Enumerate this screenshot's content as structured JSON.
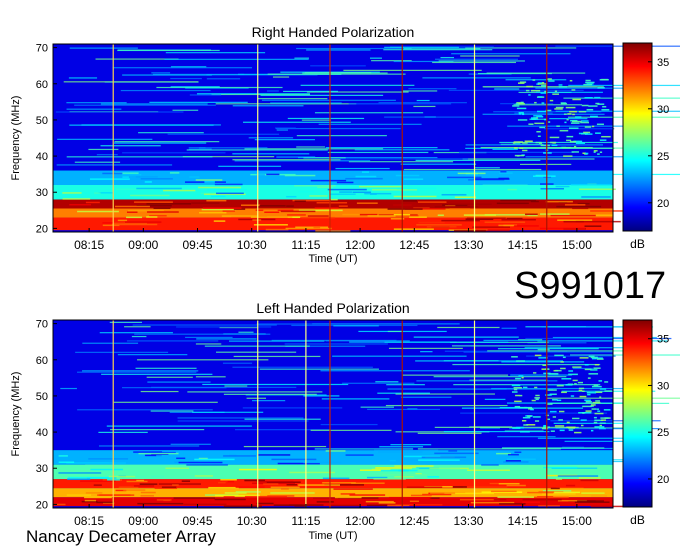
{
  "figure": {
    "observation_id": "S991017",
    "footer_label": "Nancay Decameter Array"
  },
  "colorbar": {
    "unit": "dB",
    "ticks": [
      20,
      25,
      30,
      35
    ],
    "range": [
      17,
      37
    ],
    "colormap": [
      "#00007f",
      "#0000ff",
      "#007fff",
      "#00ffff",
      "#7fff7f",
      "#ffff00",
      "#ff7f00",
      "#ff0000",
      "#7f0000"
    ]
  },
  "chart_data": [
    {
      "type": "heatmap",
      "title": "Right Handed Polarization",
      "xlabel": "Time (UT)",
      "ylabel": "Frequency (MHz)",
      "x_ticks": [
        "08:15",
        "09:00",
        "09:45",
        "10:30",
        "11:15",
        "12:00",
        "12:45",
        "13:30",
        "14:15",
        "15:00"
      ],
      "y_ticks": [
        20,
        30,
        40,
        50,
        60,
        70
      ],
      "ylim": [
        19,
        71
      ],
      "z_unit": "dB",
      "z_range": [
        17,
        37
      ],
      "background_db": 19,
      "intense_bands": [
        {
          "freq_range": [
            19.5,
            23
          ],
          "db": 34
        },
        {
          "freq_range": [
            23,
            25.5
          ],
          "db": 32
        },
        {
          "freq_range": [
            25.5,
            28
          ],
          "db": 36
        },
        {
          "freq_range": [
            28,
            32
          ],
          "db": 25
        },
        {
          "freq_range": [
            32,
            36
          ],
          "db": 23
        }
      ],
      "vertical_lines": [
        {
          "time": "08:35",
          "color": "#ffd24d"
        },
        {
          "time": "10:35",
          "color": "#ffff80"
        },
        {
          "time": "11:35",
          "color": "#cc2200"
        },
        {
          "time": "12:35",
          "color": "#aa1100"
        },
        {
          "time": "13:35",
          "color": "#ffff80"
        },
        {
          "time": "14:35",
          "color": "#aa1100"
        }
      ]
    },
    {
      "type": "heatmap",
      "title": "Left Handed Polarization",
      "xlabel": "Time (UT)",
      "ylabel": "Frequency (MHz)",
      "x_ticks": [
        "08:15",
        "09:00",
        "09:45",
        "10:30",
        "11:15",
        "12:00",
        "12:45",
        "13:30",
        "14:15",
        "15:00"
      ],
      "y_ticks": [
        20,
        30,
        40,
        50,
        60,
        70
      ],
      "ylim": [
        19,
        71
      ],
      "z_unit": "dB",
      "z_range": [
        17,
        37
      ],
      "background_db": 19,
      "intense_bands": [
        {
          "freq_range": [
            19.5,
            22
          ],
          "db": 35
        },
        {
          "freq_range": [
            22,
            24.5
          ],
          "db": 31
        },
        {
          "freq_range": [
            24.5,
            27
          ],
          "db": 34
        },
        {
          "freq_range": [
            27,
            31
          ],
          "db": 26
        },
        {
          "freq_range": [
            31,
            35
          ],
          "db": 23
        }
      ],
      "vertical_lines": [
        {
          "time": "08:35",
          "color": "#ffd24d"
        },
        {
          "time": "10:35",
          "color": "#ffff80"
        },
        {
          "time": "11:15",
          "color": "#ffff80"
        },
        {
          "time": "11:35",
          "color": "#cc2200"
        },
        {
          "time": "12:35",
          "color": "#aa1100"
        },
        {
          "time": "13:35",
          "color": "#ffff80"
        },
        {
          "time": "14:35",
          "color": "#aa1100"
        }
      ]
    }
  ]
}
